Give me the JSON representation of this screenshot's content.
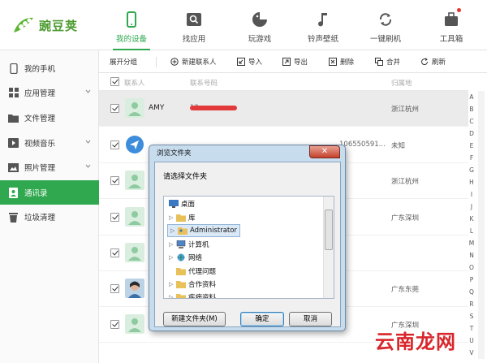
{
  "app": {
    "name": "豌豆荚",
    "brand_color": "#2fa84f"
  },
  "top_nav": [
    {
      "label": "我的设备",
      "icon": "phone-icon",
      "active": true
    },
    {
      "label": "找应用",
      "icon": "app-search-icon"
    },
    {
      "label": "玩游戏",
      "icon": "game-icon"
    },
    {
      "label": "铃声壁纸",
      "icon": "music-note-icon"
    },
    {
      "label": "一键刷机",
      "icon": "refresh-icon"
    },
    {
      "label": "工具箱",
      "icon": "toolbox-icon",
      "badge": true
    }
  ],
  "sidebar": [
    {
      "label": "我的手机",
      "icon": "phone-icon"
    },
    {
      "label": "应用管理",
      "icon": "apps-icon",
      "expandable": true
    },
    {
      "label": "文件管理",
      "icon": "folder-icon"
    },
    {
      "label": "视频音乐",
      "icon": "media-icon",
      "expandable": true
    },
    {
      "label": "照片管理",
      "icon": "photo-icon",
      "expandable": true
    },
    {
      "label": "通讯录",
      "icon": "contacts-icon",
      "active": true
    },
    {
      "label": "垃圾清理",
      "icon": "trash-icon"
    }
  ],
  "toolbar": {
    "group": "展开分组",
    "new_contact": "新建联系人",
    "import": "导入",
    "export": "导出",
    "delete": "删除",
    "merge": "合并",
    "refresh": "刷新"
  },
  "table": {
    "headers": {
      "contact": "联系人",
      "phone": "联系号码",
      "location": "归属地"
    },
    "rows": [
      {
        "name": "AMY",
        "phone": "13",
        "location": "浙江杭州",
        "redacted": true,
        "selected": true
      },
      {
        "name": "",
        "phone": "106550591...",
        "location": "未知",
        "avatar": "sender"
      },
      {
        "name": "",
        "phone": "",
        "location": "浙江杭州"
      },
      {
        "name": "",
        "phone": "",
        "location": "广东深圳"
      },
      {
        "name": "",
        "phone": "",
        "location": ""
      },
      {
        "name": "",
        "phone": "",
        "location": "广东东莞",
        "avatar": "photo"
      },
      {
        "name": "",
        "phone": "",
        "location": "广东深圳"
      }
    ]
  },
  "az_index": [
    "A",
    "B",
    "C",
    "D",
    "E",
    "F",
    "G",
    "H",
    "I",
    "J",
    "K",
    "L",
    "M",
    "N",
    "O",
    "P",
    "Q",
    "R",
    "S",
    "T",
    "U",
    "V"
  ],
  "dialog": {
    "title": "浏览文件夹",
    "close": "✕",
    "prompt": "请选择文件夹",
    "tree": [
      {
        "label": "桌面",
        "level": 0,
        "icon": "desktop-icon",
        "expander": false
      },
      {
        "label": "库",
        "level": 1,
        "icon": "library-icon",
        "expander": true
      },
      {
        "label": "Administrator",
        "level": 1,
        "icon": "user-folder-icon",
        "expander": true,
        "selected": true
      },
      {
        "label": "计算机",
        "level": 1,
        "icon": "computer-icon",
        "expander": true
      },
      {
        "label": "网络",
        "level": 1,
        "icon": "network-icon",
        "expander": true
      },
      {
        "label": "代理问题",
        "level": 1,
        "icon": "folder-icon",
        "expander": false
      },
      {
        "label": "合作资料",
        "level": 1,
        "icon": "folder-icon",
        "expander": true
      },
      {
        "label": "疾病资料",
        "level": 1,
        "icon": "folder-icon",
        "expander": true
      }
    ],
    "buttons": {
      "new_folder": "新建文件夹(M)",
      "ok": "确定",
      "cancel": "取消"
    }
  },
  "watermark": "云南龙网"
}
